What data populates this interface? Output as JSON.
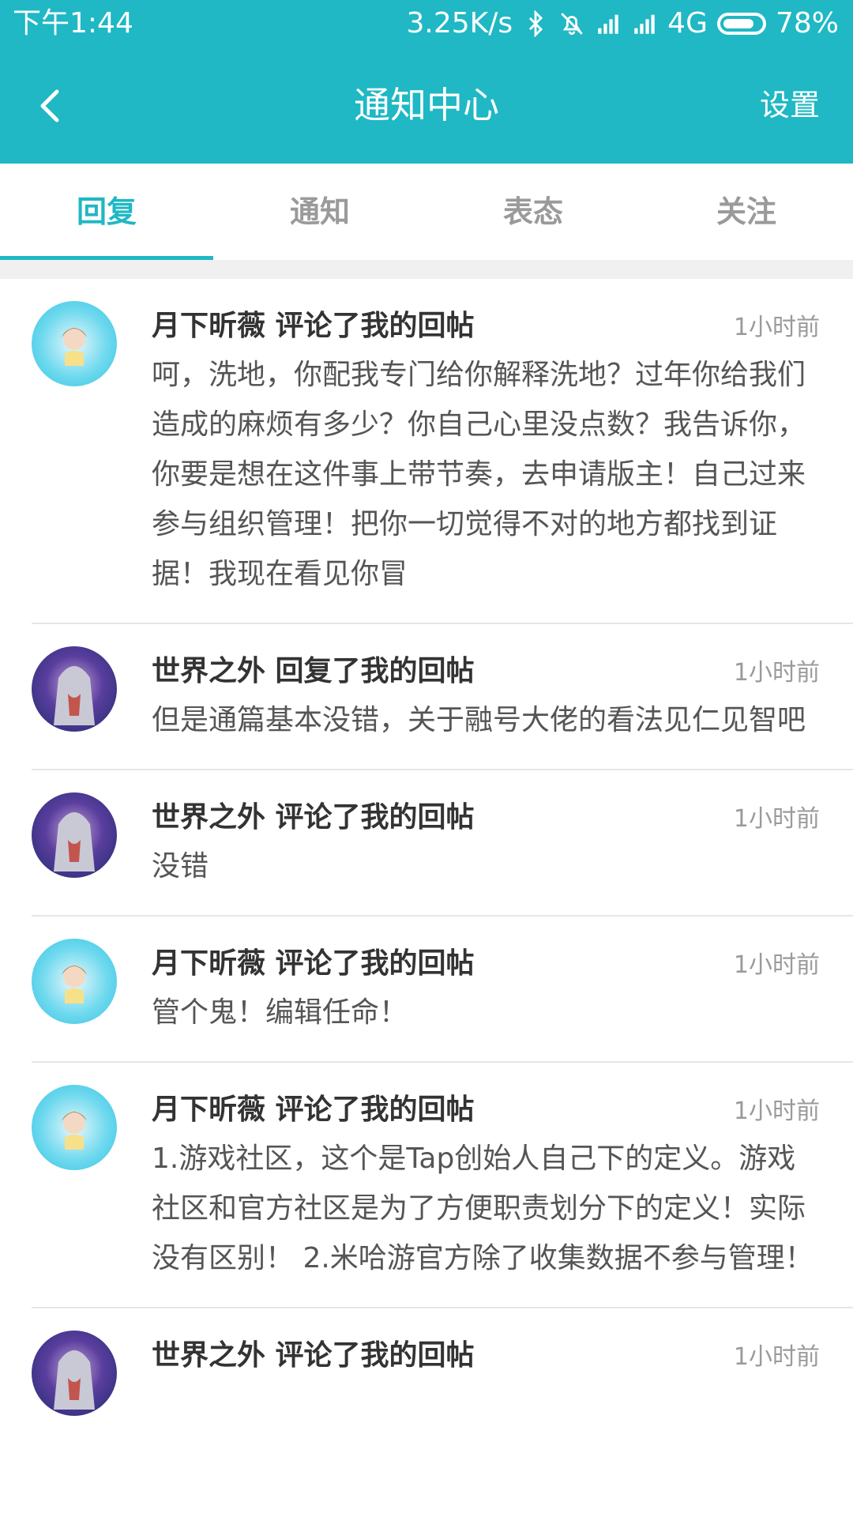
{
  "status_bar": {
    "time": "下午1:44",
    "net_speed": "3.25K/s",
    "network": "4G",
    "battery": "78%",
    "icons": [
      "bluetooth-icon",
      "mute-icon",
      "signal-icon",
      "hd-signal-icon",
      "battery-icon"
    ]
  },
  "header": {
    "title": "通知中心",
    "settings_label": "设置",
    "back_icon": "chevron-left-icon",
    "color": "#1fb8c4"
  },
  "tabs": [
    {
      "label": "回复",
      "active": true
    },
    {
      "label": "通知",
      "active": false
    },
    {
      "label": "表态",
      "active": false
    },
    {
      "label": "关注",
      "active": false
    }
  ],
  "items": [
    {
      "title": "月下昕薇 评论了我的回帖",
      "time": "1小时前",
      "avatar": "avatar-blue",
      "body": "呵，洗地，你配我专门给你解释洗地？过年你给我们造成的麻烦有多少？你自己心里没点数？我告诉你，你要是想在这件事上带节奏，去申请版主！自己过来参与组织管理！把你一切觉得不对的地方都找到证据！我现在看见你冒"
    },
    {
      "title": "世界之外 回复了我的回帖",
      "time": "1小时前",
      "avatar": "avatar-purple",
      "body": "但是通篇基本没错，关于融号大佬的看法见仁见智吧"
    },
    {
      "title": "世界之外 评论了我的回帖",
      "time": "1小时前",
      "avatar": "avatar-purple",
      "body": "没错"
    },
    {
      "title": "月下昕薇 评论了我的回帖",
      "time": "1小时前",
      "avatar": "avatar-blue",
      "body": "管个鬼！编辑任命！"
    },
    {
      "title": "月下昕薇 评论了我的回帖",
      "time": "1小时前",
      "avatar": "avatar-blue",
      "body": "1.游戏社区，这个是Tap创始人自己下的定义。游戏社区和官方社区是为了方便职责划分下的定义！实际没有区别！ 2.米哈游官方除了收集数据不参与管理！"
    },
    {
      "title": "世界之外 评论了我的回帖",
      "time": "1小时前",
      "avatar": "avatar-purple",
      "body": ""
    }
  ]
}
